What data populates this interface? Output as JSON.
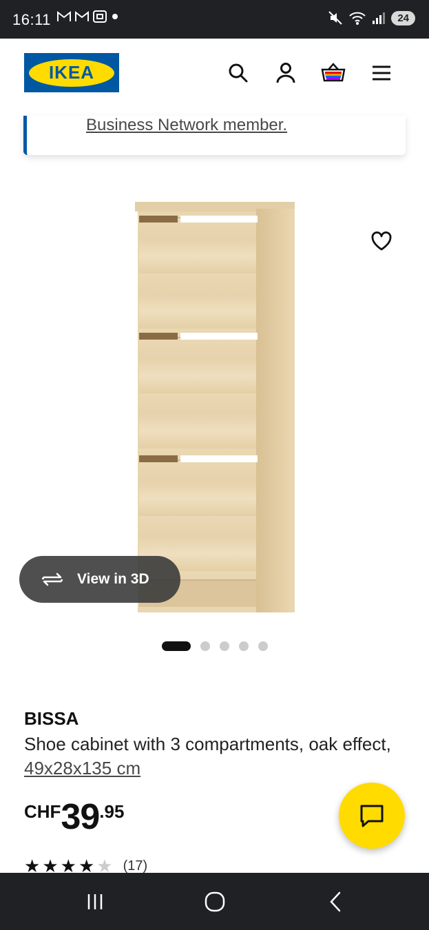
{
  "status_bar": {
    "time": "16:11",
    "left_icons": [
      "gmail-icon",
      "gmail-icon",
      "screenshot-icon",
      "dot"
    ],
    "right_icons": [
      "mute-icon",
      "wifi-icon",
      "signal-icon"
    ],
    "battery": "24"
  },
  "header": {
    "logo_text": "IKEA",
    "icons": [
      "search-icon",
      "account-icon",
      "basket-icon",
      "menu-icon"
    ]
  },
  "card": {
    "link_text": "Business Network member."
  },
  "product": {
    "view3d_label": "View in 3D",
    "carousel_total": 5,
    "carousel_active": 1,
    "name": "BISSA",
    "description": "Shoe cabinet with 3 compartments, oak effect,",
    "dimensions": "49x28x135 cm",
    "price_currency": "CHF",
    "price_int": "39",
    "price_dec": ".95",
    "rating": 4,
    "rating_max": 5,
    "rating_count": "(17)"
  },
  "colors": {
    "ikea_blue": "#0058a3",
    "ikea_yellow": "#ffdb00",
    "system_bar": "#202124"
  }
}
